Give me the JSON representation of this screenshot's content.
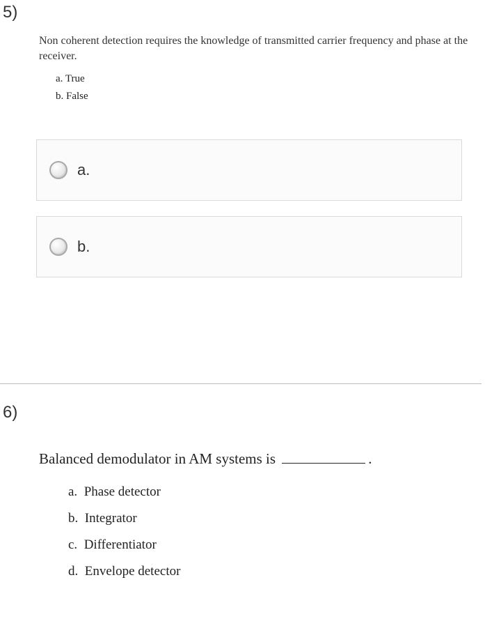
{
  "questions": {
    "q5": {
      "number": "5)",
      "prompt": "Non coherent detection requires the knowledge of transmitted carrier frequency and phase at the receiver.",
      "items": [
        {
          "letter": "a.",
          "text": "True"
        },
        {
          "letter": "b.",
          "text": "False"
        }
      ],
      "answers": [
        {
          "label": "a."
        },
        {
          "label": "b."
        }
      ]
    },
    "q6": {
      "number": "6)",
      "prompt_pre": "Balanced demodulator in AM systems is ",
      "prompt_post": ".",
      "items": [
        {
          "letter": "a.",
          "text": "Phase detector"
        },
        {
          "letter": "b.",
          "text": "Integrator"
        },
        {
          "letter": "c.",
          "text": "Differentiator"
        },
        {
          "letter": "d.",
          "text": "Envelope detector"
        }
      ]
    }
  }
}
